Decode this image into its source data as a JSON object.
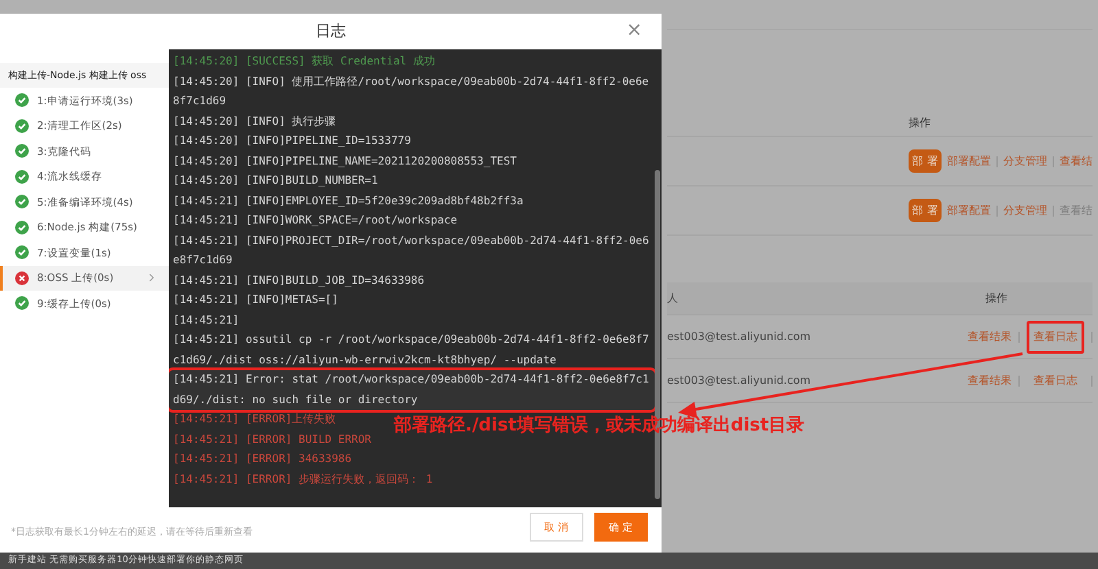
{
  "dialog": {
    "title": "日志",
    "close": "×",
    "pipeline_title": "构建上传-Node.js 构建上传 oss",
    "steps": [
      {
        "label": "1:申请运行环境(3s)",
        "failed": false,
        "selected": false
      },
      {
        "label": "2:清理工作区(2s)",
        "failed": false,
        "selected": false
      },
      {
        "label": "3:克隆代码",
        "failed": false,
        "selected": false
      },
      {
        "label": "4:流水线缓存",
        "failed": false,
        "selected": false
      },
      {
        "label": "5:准备编译环境(4s)",
        "failed": false,
        "selected": false
      },
      {
        "label": "6:Node.js 构建(75s)",
        "failed": false,
        "selected": false
      },
      {
        "label": "7:设置变量(1s)",
        "failed": false,
        "selected": false
      },
      {
        "label": "8:OSS 上传(0s)",
        "failed": true,
        "selected": true
      },
      {
        "label": "9:缓存上传(0s)",
        "failed": false,
        "selected": false
      }
    ],
    "log": [
      {
        "kind": "success",
        "text": "[14:45:20] [SUCCESS] 获取 Credential 成功",
        "annotated": false
      },
      {
        "kind": "info",
        "text": "[14:45:20] [INFO] 使用工作路径/root/workspace/09eab00b-2d74-44f1-8ff2-0e6e8f7c1d69",
        "annotated": false
      },
      {
        "kind": "info",
        "text": "[14:45:20] [INFO] 执行步骤",
        "annotated": false
      },
      {
        "kind": "info",
        "text": "[14:45:20] [INFO]PIPELINE_ID=1533779",
        "annotated": false
      },
      {
        "kind": "info",
        "text": "[14:45:20] [INFO]PIPELINE_NAME=2021120200808553_TEST",
        "annotated": false
      },
      {
        "kind": "info",
        "text": "[14:45:20] [INFO]BUILD_NUMBER=1",
        "annotated": false
      },
      {
        "kind": "info",
        "text": "[14:45:21] [INFO]EMPLOYEE_ID=5f20e39c209ad8bf48b2ff3a",
        "annotated": false
      },
      {
        "kind": "info",
        "text": "[14:45:21] [INFO]WORK_SPACE=/root/workspace",
        "annotated": false
      },
      {
        "kind": "info",
        "text": "[14:45:21] [INFO]PROJECT_DIR=/root/workspace/09eab00b-2d74-44f1-8ff2-0e6e8f7c1d69",
        "annotated": false
      },
      {
        "kind": "info",
        "text": "[14:45:21] [INFO]BUILD_JOB_ID=34633986",
        "annotated": false
      },
      {
        "kind": "info",
        "text": "[14:45:21] [INFO]METAS=[]",
        "annotated": false
      },
      {
        "kind": "info",
        "text": "[14:45:21]",
        "annotated": false
      },
      {
        "kind": "info",
        "text": "[14:45:21] ossutil cp -r /root/workspace/09eab00b-2d74-44f1-8ff2-0e6e8f7c1d69/./dist oss://aliyun-wb-errwiv2kcm-kt8bhyep/ --update",
        "annotated": false
      },
      {
        "kind": "info",
        "text": "[14:45:21] Error: stat /root/workspace/09eab00b-2d74-44f1-8ff2-0e6e8f7c1d69/./dist: no such file or directory",
        "annotated": true
      },
      {
        "kind": "error",
        "text": "[14:45:21] [ERROR]上传失败",
        "annotated": false
      },
      {
        "kind": "error",
        "text": "[14:45:21] [ERROR] BUILD ERROR",
        "annotated": false
      },
      {
        "kind": "error",
        "text": "[14:45:21] [ERROR] 34633986",
        "annotated": false
      },
      {
        "kind": "error",
        "text": "[14:45:21] [ERROR] 步骤运行失败，返回码： 1",
        "annotated": false
      }
    ],
    "note": "*日志获取有最长1分钟左右的延迟，请在等待后重新查看",
    "buttons": [
      {
        "label": "取 消",
        "kind": "secondary"
      },
      {
        "label": "确 定",
        "kind": "primary"
      }
    ]
  },
  "annotation": "部署路径./dist填写错误，或未成功编译出dist目录",
  "background": {
    "table_1": {
      "header": "操作",
      "rows": [
        {
          "deploy": "部 署",
          "links": [
            "部署配置",
            "分支管理",
            "查看结"
          ],
          "last_disabled": false
        },
        {
          "deploy": "部 署",
          "links": [
            "部署配置",
            "分支管理",
            "查看结"
          ],
          "last_disabled": true
        }
      ]
    },
    "table_2": {
      "column_1": "人",
      "header": "操作",
      "rows": [
        {
          "owner": "est003@test.aliyunid.com",
          "links": [
            "查看结果",
            "查看日志"
          ],
          "annotated": true
        },
        {
          "owner": "est003@test.aliyunid.com",
          "links": [
            "查看结果",
            "查看日志"
          ],
          "annotated": false
        }
      ]
    }
  },
  "footer_bar": "新手建站 无需购买服务器10分钟快速部署你的静态网页"
}
